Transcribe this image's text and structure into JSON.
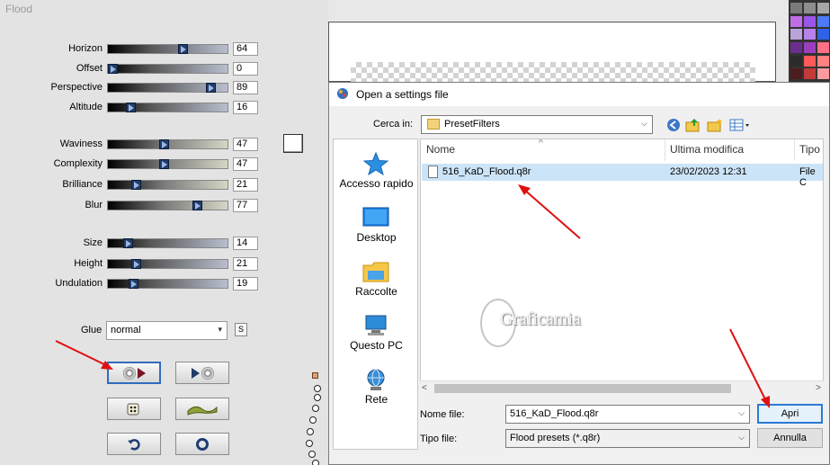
{
  "flood": {
    "title": "Flood",
    "sliders": [
      {
        "label": "Horizon",
        "value": "64",
        "fraction": 0.64
      },
      {
        "label": "Offset",
        "value": "0",
        "fraction": 0.0
      },
      {
        "label": "Perspective",
        "value": "89",
        "fraction": 0.89
      },
      {
        "label": "Altitude",
        "value": "16",
        "fraction": 0.16
      },
      {
        "label": "Waviness",
        "value": "47",
        "fraction": 0.47
      },
      {
        "label": "Complexity",
        "value": "47",
        "fraction": 0.47
      },
      {
        "label": "Brilliance",
        "value": "21",
        "fraction": 0.21
      },
      {
        "label": "Blur",
        "value": "77",
        "fraction": 0.77
      },
      {
        "label": "Size",
        "value": "14",
        "fraction": 0.14
      },
      {
        "label": "Height",
        "value": "21",
        "fraction": 0.21
      },
      {
        "label": "Undulation",
        "value": "19",
        "fraction": 0.19
      }
    ],
    "glue": {
      "label": "Glue",
      "value": "normal",
      "s_button": "S"
    },
    "tool_buttons": [
      {
        "name": "load-preset-button",
        "icon": "disc-play-icon",
        "selected": true
      },
      {
        "name": "save-preset-button",
        "icon": "play-disc-icon",
        "selected": false
      },
      {
        "name": "random-button",
        "icon": "dice-icon",
        "selected": false
      },
      {
        "name": "wave-button",
        "icon": "wave-icon",
        "selected": false
      },
      {
        "name": "reset-button",
        "icon": "undo-icon",
        "selected": false
      },
      {
        "name": "about-button",
        "icon": "ring-icon",
        "selected": false
      }
    ]
  },
  "palette": {
    "colors": [
      "#7b7b7b",
      "#8e8e8e",
      "#a6a6a6",
      "#c16ee6",
      "#9a56e8",
      "#4b7cf6",
      "#b9a3d8",
      "#b782ea",
      "#2f62e8",
      "#6b2d8f",
      "#9b3fbf",
      "#ff6f86",
      "#2b2b2b",
      "#ff5a5a",
      "#ff8080",
      "#4e1c1c",
      "#c23a3a",
      "#ff9aa0"
    ]
  },
  "dialog": {
    "title": "Open a settings file",
    "look_in_label": "Cerca in:",
    "look_in_value": "PresetFilters",
    "places": [
      {
        "label": "Accesso rapido",
        "icon": "star-icon"
      },
      {
        "label": "Desktop",
        "icon": "desktop-icon"
      },
      {
        "label": "Raccolte",
        "icon": "library-folder-icon"
      },
      {
        "label": "Questo PC",
        "icon": "computer-icon"
      },
      {
        "label": "Rete",
        "icon": "network-icon"
      }
    ],
    "columns": [
      "Nome",
      "Ultima modifica",
      "Tipo"
    ],
    "files": [
      {
        "name": "516_KaD_Flood.q8r",
        "modified": "23/02/2023 12:31",
        "type": "File C"
      }
    ],
    "file_name_label": "Nome file:",
    "file_name_value": "516_KaD_Flood.q8r",
    "file_type_label": "Tipo file:",
    "file_type_value": "Flood presets (*.q8r)",
    "open_label": "Apri",
    "cancel_label": "Annulla",
    "watermark": "Graficamia"
  },
  "colors": {
    "annotation_arrow": "#e01010",
    "selection": "#cce4f7",
    "default_button_border": "#2b7ad4"
  }
}
